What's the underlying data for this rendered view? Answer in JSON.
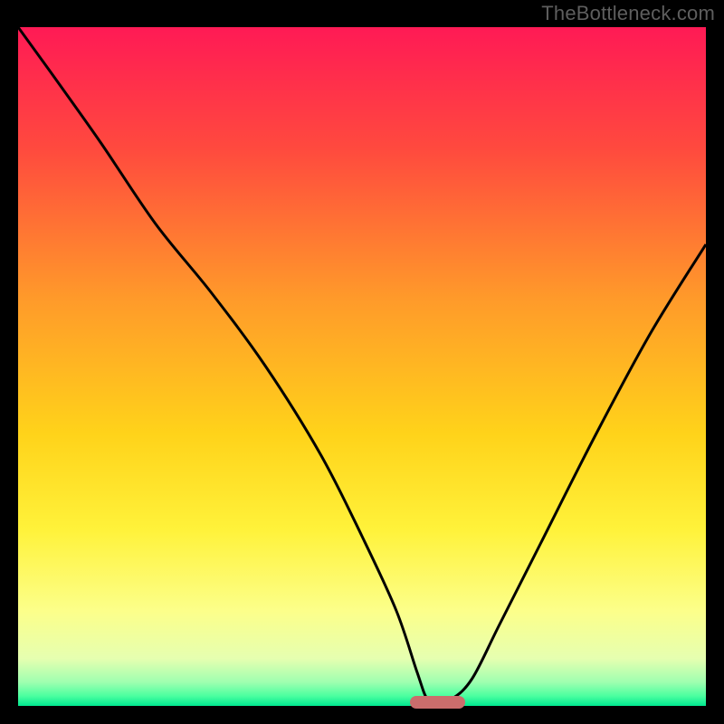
{
  "watermark": "TheBottleneck.com",
  "chart_data": {
    "type": "line",
    "title": "",
    "xlabel": "",
    "ylabel": "",
    "xlim": [
      0,
      100
    ],
    "ylim": [
      0,
      100
    ],
    "grid": false,
    "legend": false,
    "gradient_stops": [
      {
        "offset": 0,
        "color": "#ff1a55"
      },
      {
        "offset": 0.18,
        "color": "#ff4a3e"
      },
      {
        "offset": 0.4,
        "color": "#ff9a2a"
      },
      {
        "offset": 0.6,
        "color": "#ffd31a"
      },
      {
        "offset": 0.74,
        "color": "#fff23a"
      },
      {
        "offset": 0.86,
        "color": "#fcff8a"
      },
      {
        "offset": 0.93,
        "color": "#e6ffb0"
      },
      {
        "offset": 0.965,
        "color": "#9fffb0"
      },
      {
        "offset": 0.985,
        "color": "#4dffa0"
      },
      {
        "offset": 1.0,
        "color": "#00e890"
      }
    ],
    "series": [
      {
        "name": "bottleneck-curve",
        "color": "#000000",
        "x": [
          0,
          5,
          12,
          20,
          28,
          36,
          44,
          50,
          55,
          58,
          59.5,
          61,
          63,
          66,
          70,
          76,
          84,
          92,
          100
        ],
        "y": [
          100,
          93,
          83,
          71,
          61,
          50,
          37,
          25,
          14,
          5,
          1,
          1,
          1,
          4,
          12,
          24,
          40,
          55,
          68
        ]
      }
    ],
    "marker": {
      "x_start": 57,
      "x_end": 65,
      "y": 0.5,
      "color": "#cb6d6c"
    }
  }
}
